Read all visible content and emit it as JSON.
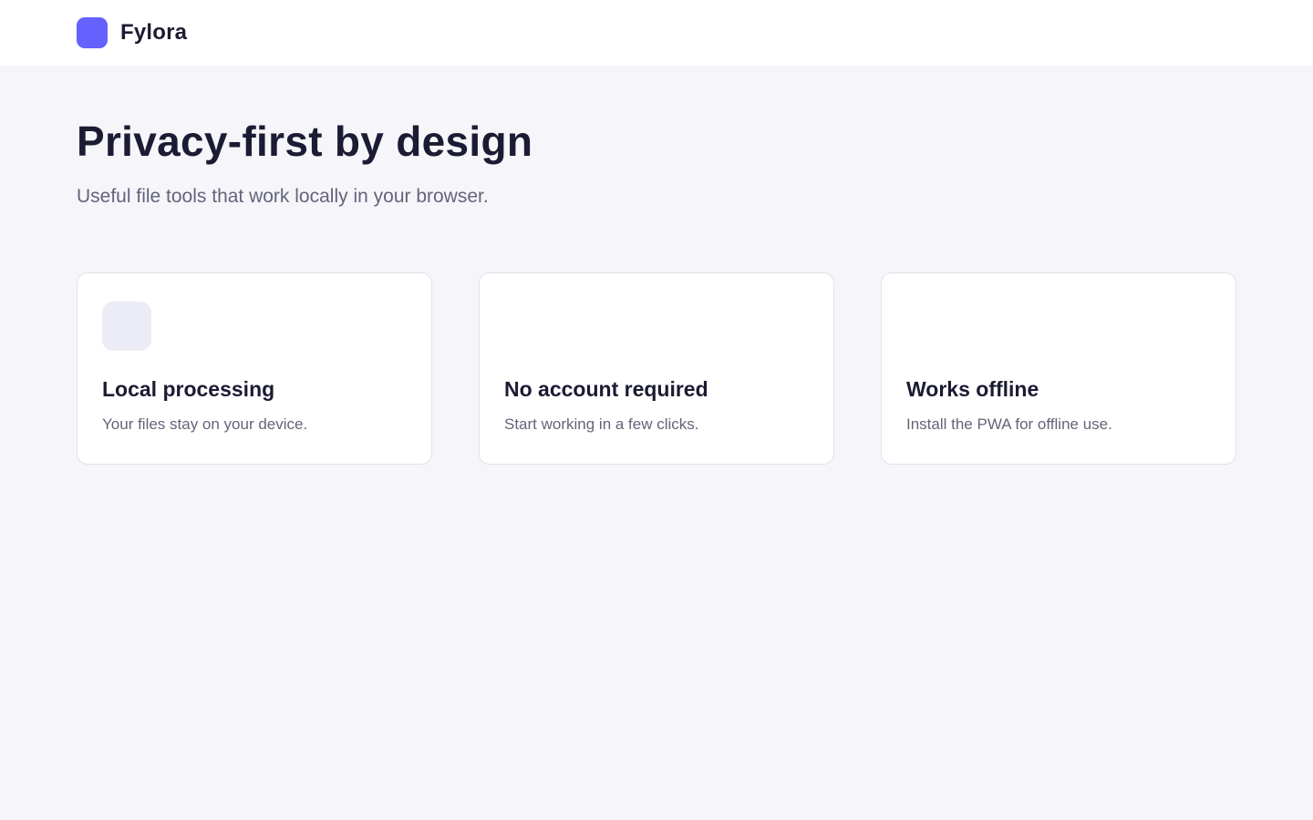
{
  "header": {
    "brand": "Fylora",
    "logo_icon": "fylora-logo-icon",
    "logo_color": "#6561ff"
  },
  "hero": {
    "title": "Privacy-first by design",
    "subtitle": "Useful file tools that work locally in your browser."
  },
  "features": [
    {
      "icon": "feature-icon-placeholder",
      "title": "Local processing",
      "description": "Your files stay on your device."
    },
    {
      "title": "No account required",
      "description": "Start working in a few clicks."
    },
    {
      "title": "Works offline",
      "description": "Install the PWA for offline use."
    }
  ],
  "colors": {
    "background": "#f5f5fa",
    "surface": "#ffffff",
    "text_primary": "#1b1b33",
    "text_secondary": "#64647a",
    "accent": "#6561ff"
  }
}
